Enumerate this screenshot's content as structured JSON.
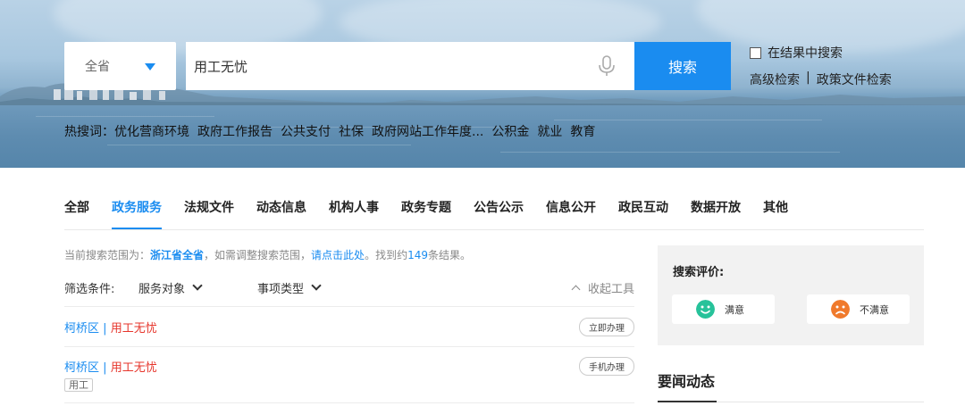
{
  "search": {
    "region": "全省",
    "query": "用工无忧",
    "button_label": "搜索",
    "in_results_label": "在结果中搜索",
    "advanced_label": "高级检索",
    "separator": "|",
    "policy_label": "政策文件检索",
    "mic_icon": "microphone-icon",
    "accent_color": "#1a8cf0"
  },
  "hot": {
    "title": "热搜词：",
    "words": [
      "优化营商环境",
      "政府工作报告",
      "公共支付",
      "社保",
      "政府网站工作年度...",
      "公积金",
      "就业",
      "教育"
    ]
  },
  "tabs": [
    "全部",
    "政务服务",
    "法规文件",
    "动态信息",
    "机构人事",
    "政务专题",
    "公告公示",
    "信息公开",
    "政民互动",
    "数据开放",
    "其他"
  ],
  "active_tab": "政务服务",
  "scope": {
    "prefix": "当前搜索范围为：",
    "range": "浙江省全省",
    "middle": "，如需调整搜索范围，",
    "link": "请点击此处",
    "suffix_before": "。找到约",
    "count": "149",
    "suffix_after": "条结果。"
  },
  "filters": {
    "label": "筛选条件:",
    "items": [
      "服务对象",
      "事项类型"
    ],
    "collapse": "收起工具"
  },
  "results": [
    {
      "area": "柯桥区",
      "sep": "|",
      "name": "用工无忧",
      "action": "立即办理",
      "tag": ""
    },
    {
      "area": "柯桥区",
      "sep": "|",
      "name": "用工无忧",
      "action": "手机办理",
      "tag": "用工"
    }
  ],
  "rating": {
    "title": "搜索评价:",
    "satisfied": "满意",
    "unsatisfied": "不满意",
    "satisfied_color": "#27c29a",
    "unsatisfied_color": "#f07a2c"
  },
  "news": {
    "title": "要闻动态"
  }
}
